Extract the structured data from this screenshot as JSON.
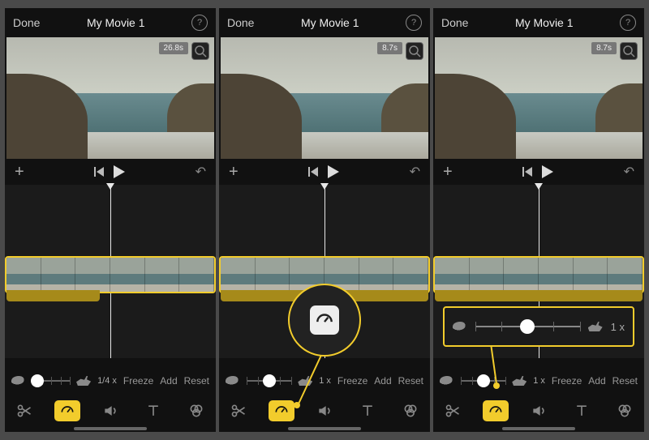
{
  "screens": [
    {
      "header": {
        "done": "Done",
        "title": "My Movie 1"
      },
      "preview": {
        "timestamp": "26.8s"
      },
      "speed": {
        "knob_pct": 14,
        "speed_label": "1/4 x",
        "freeze": "Freeze",
        "add": "Add",
        "reset": "Reset"
      },
      "tools": {
        "active": "speed"
      }
    },
    {
      "header": {
        "done": "Done",
        "title": "My Movie 1"
      },
      "preview": {
        "timestamp": "8.7s"
      },
      "speed": {
        "knob_pct": 50,
        "speed_label": "1 x",
        "freeze": "Freeze",
        "add": "Add",
        "reset": "Reset"
      },
      "tools": {
        "active": "speed"
      }
    },
    {
      "header": {
        "done": "Done",
        "title": "My Movie 1"
      },
      "preview": {
        "timestamp": "8.7s"
      },
      "speed": {
        "knob_pct": 50,
        "speed_label": "1 x",
        "freeze": "Freeze",
        "add": "Add",
        "reset": "Reset"
      },
      "callout_speed_label": "1 x",
      "tools": {
        "active": "speed"
      }
    }
  ]
}
